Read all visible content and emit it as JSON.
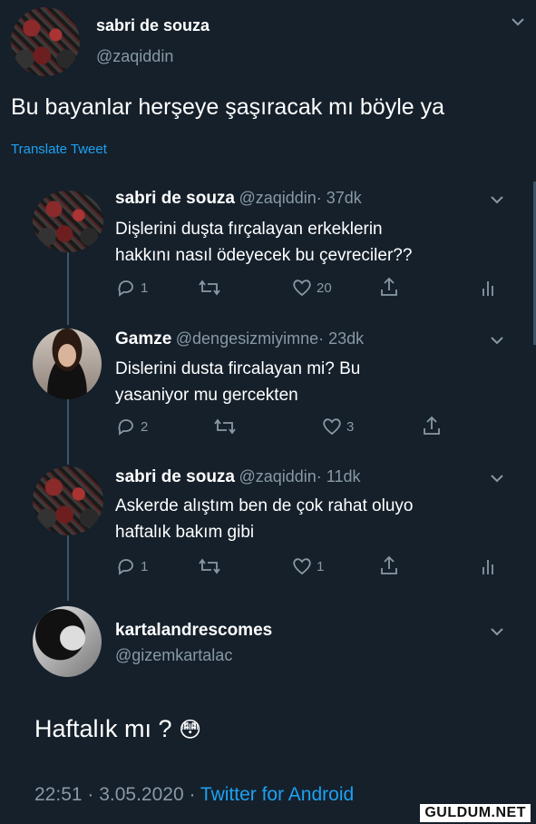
{
  "main_tweet": {
    "name": "sabri de souza",
    "handle": "@zaqiddin",
    "text": "Bu bayanlar herşeye şaşıracak mı böyle ya",
    "translate": "Translate Tweet"
  },
  "replies": [
    {
      "name": "sabri de souza",
      "handle": "@zaqiddin",
      "time": "· 37dk",
      "text1": "Dişlerini duşta fırçalayan erkeklerin",
      "text2": "hakkını nasıl ödeyecek bu çevreciler??",
      "replies": "1",
      "likes": "20"
    },
    {
      "name": "Gamze",
      "handle": "@dengesizmiyimne",
      "time": "· 23dk",
      "text1": "Dislerini dusta fircalayan mi? Bu",
      "text2": "yasaniyor mu gercekten",
      "replies": "2",
      "likes": "3"
    },
    {
      "name": "sabri de souza",
      "handle": "@zaqiddin",
      "time": "· 11dk",
      "text1": "Askerde alıştım ben de çok rahat oluyo",
      "text2": "haftalık bakım gibi",
      "replies": "1",
      "likes": "1"
    }
  ],
  "focus_tweet": {
    "name": "kartalandrescomes",
    "handle": "@gizemkartalac",
    "text": "Haftalık mı ?",
    "emoji": "😳",
    "timestamp": "22:51 · 3.05.2020 · ",
    "source": "Twitter for Android"
  },
  "watermark": "GULDUM.NET",
  "colors": {
    "background": "#15202b",
    "secondary_text": "#8899a6",
    "link": "#1da1f2"
  }
}
